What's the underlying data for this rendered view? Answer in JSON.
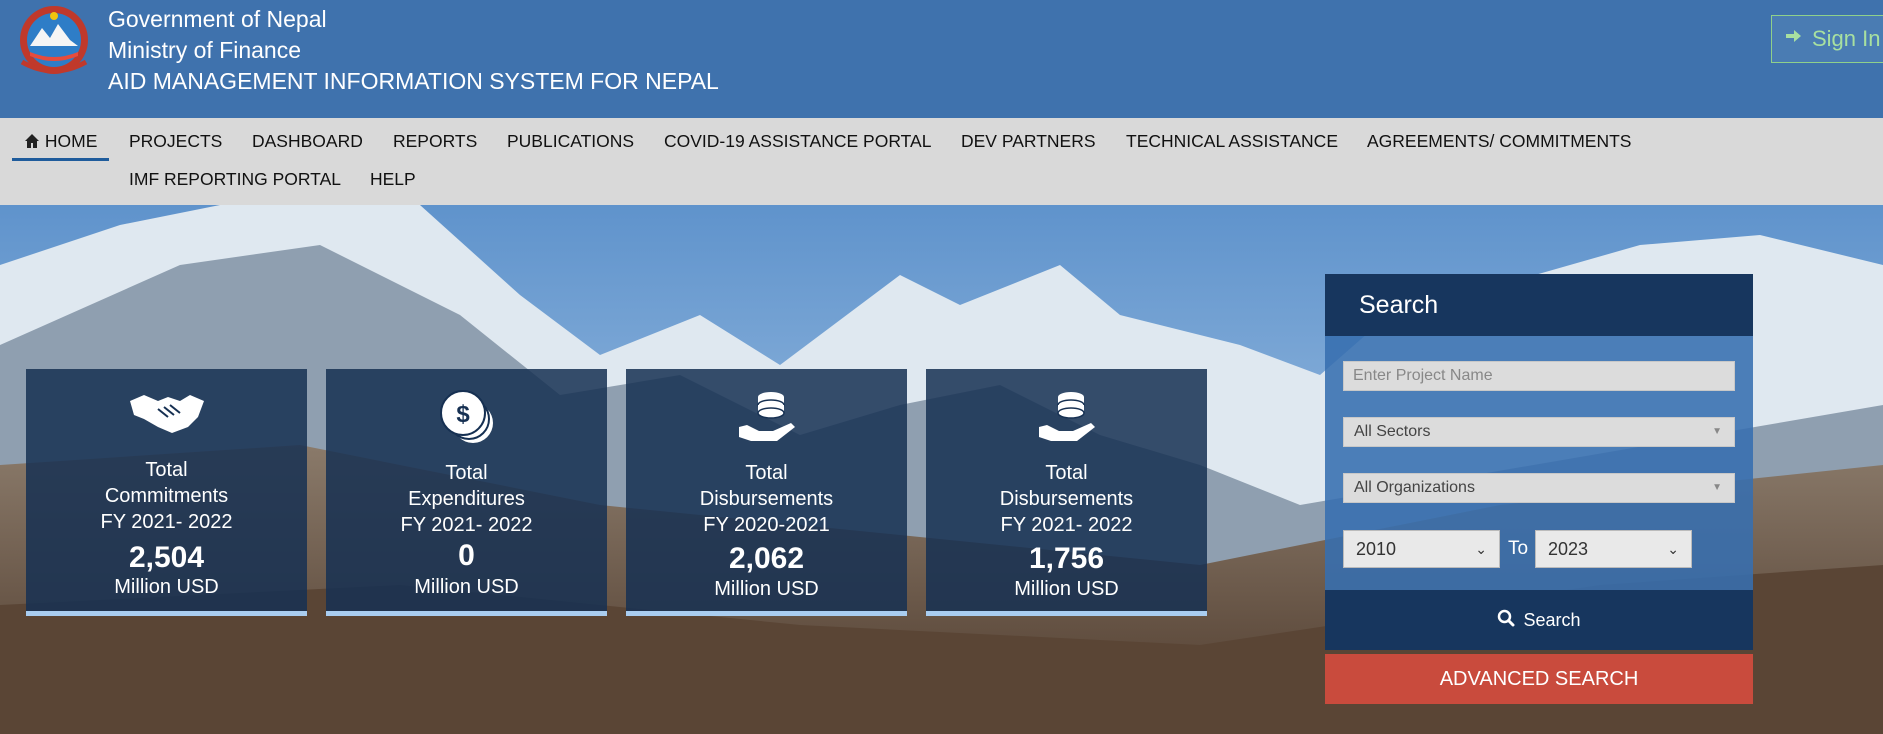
{
  "header": {
    "line1": "Government of Nepal",
    "line2": "Ministry of Finance",
    "line3": "AID MANAGEMENT INFORMATION SYSTEM FOR NEPAL",
    "signin_label": "Sign In",
    "emblem_icon": "nepal-emblem-icon"
  },
  "nav": {
    "items": [
      {
        "label": "HOME",
        "icon": "home-icon"
      },
      {
        "label": "PROJECTS"
      },
      {
        "label": "DASHBOARD"
      },
      {
        "label": "REPORTS"
      },
      {
        "label": "PUBLICATIONS"
      },
      {
        "label": "COVID-19 ASSISTANCE PORTAL"
      },
      {
        "label": "DEV PARTNERS"
      },
      {
        "label": "TECHNICAL ASSISTANCE"
      },
      {
        "label": "AGREEMENTS/ COMMITMENTS"
      },
      {
        "label": "IMF REPORTING PORTAL"
      },
      {
        "label": "HELP"
      }
    ]
  },
  "cards": [
    {
      "icon": "handshake-icon",
      "l1": "Total",
      "l2": "Commitments",
      "l3": "FY 2021- 2022",
      "value": "2,504",
      "unit": "Million USD"
    },
    {
      "icon": "coins-icon",
      "l1": "Total",
      "l2": "Expenditures",
      "l3": "FY 2021- 2022",
      "value": "0",
      "unit": "Million USD"
    },
    {
      "icon": "hand-coins-icon",
      "l1": "Total",
      "l2": "Disbursements",
      "l3": "FY 2020-2021",
      "value": "2,062",
      "unit": "Million USD"
    },
    {
      "icon": "hand-coins-icon",
      "l1": "Total",
      "l2": "Disbursements",
      "l3": "FY 2021- 2022",
      "value": "1,756",
      "unit": "Million USD"
    }
  ],
  "search": {
    "title": "Search",
    "project_placeholder": "Enter Project Name",
    "sector_value": "All Sectors",
    "org_value": "All Organizations",
    "from_year": "2010",
    "to_label": "To",
    "to_year": "2023",
    "search_label": "Search",
    "advanced_label": "ADVANCED SEARCH"
  },
  "colors": {
    "header_bg": "#3f72ad",
    "nav_bg": "#d9d9d9",
    "card_bg": "#163052",
    "panel_head": "#17365e",
    "advanced_btn": "#c94b3d",
    "signin_green": "#a8e0a0"
  }
}
